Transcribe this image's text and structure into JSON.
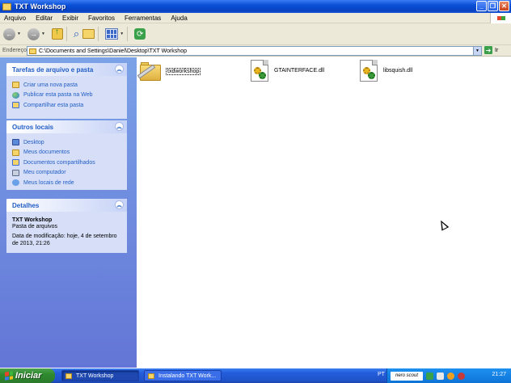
{
  "window": {
    "title": "TXT Workshop",
    "buttons": {
      "minimize": "_",
      "maximize": "❐",
      "close": "✕"
    }
  },
  "menubar": {
    "items": [
      "Arquivo",
      "Editar",
      "Exibir",
      "Favoritos",
      "Ferramentas",
      "Ajuda"
    ]
  },
  "toolbar": {
    "back_icon": "back-arrow-icon",
    "forward_icon": "forward-arrow-icon",
    "up_icon": "folder-up-icon",
    "search_icon": "search-icon",
    "folders_icon": "folders-icon",
    "views_icon": "views-icon",
    "sync_icon": "sync-icon"
  },
  "address": {
    "label": "Endereço",
    "value": "C:\\Documents and Settings\\Daniel\\Desktop\\TXT Workshop",
    "go_label": "Ir"
  },
  "sidebar": {
    "tasks": {
      "title": "Tarefas de arquivo e pasta",
      "items": [
        "Criar uma nova pasta",
        "Publicar esta pasta na Web",
        "Compartilhar esta pasta"
      ]
    },
    "places": {
      "title": "Outros locais",
      "items": [
        "Desktop",
        "Meus documentos",
        "Documentos compartilhados",
        "Meu computador",
        "Meus locais de rede"
      ]
    },
    "details": {
      "title": "Detalhes",
      "name": "TXT Workshop",
      "type": "Pasta de arquivos",
      "modified_line1": "Data de modificação: hoje, 4 de setembro",
      "modified_line2": "de 2013, 21:26"
    }
  },
  "files": [
    {
      "name": "txdworkshop",
      "kind": "folder",
      "selected": true
    },
    {
      "name": "GTAINTERFACE.dll",
      "kind": "dll"
    },
    {
      "name": "libsquish.dll",
      "kind": "dll"
    }
  ],
  "taskbar": {
    "start_label": "Iniciar",
    "tasks": [
      "TXT Workshop",
      "Instalando TXT Work..."
    ],
    "language": "PT",
    "nero_label": "nero scout",
    "clock": "21:27"
  }
}
